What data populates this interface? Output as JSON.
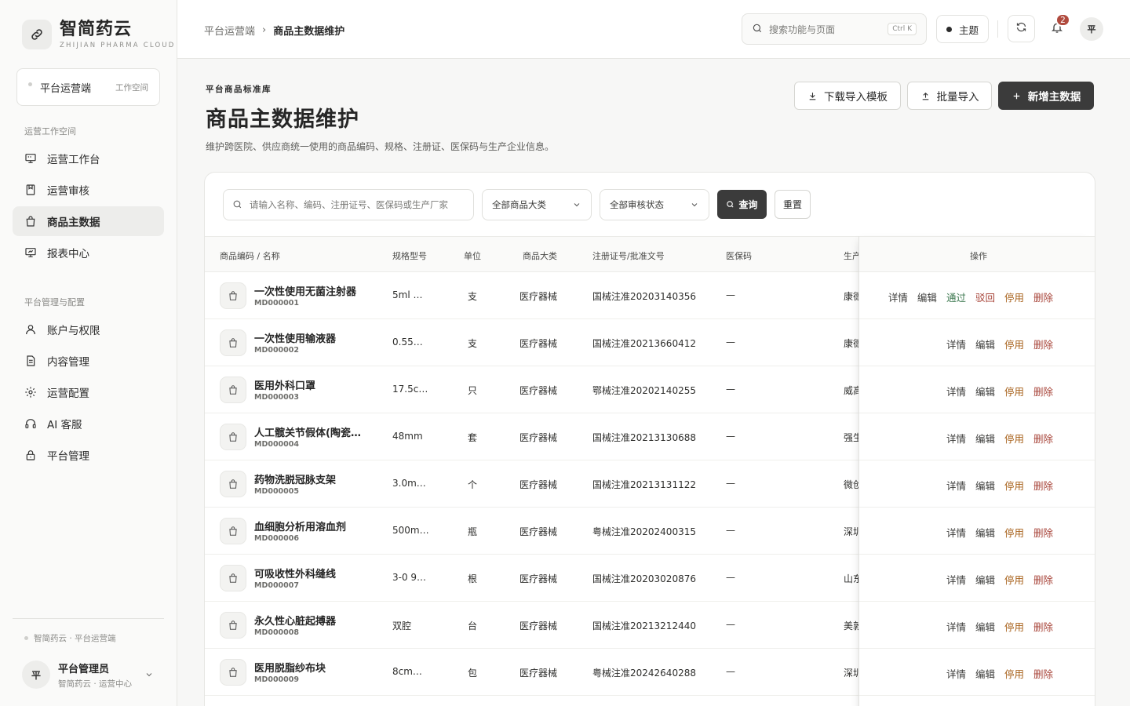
{
  "brand": {
    "name": "智简药云",
    "subtitle": "ZHIJIAN PHARMA CLOUD",
    "logo_icon": "link-icon"
  },
  "workspace": {
    "name": "平台运营端",
    "tag": "工作空间"
  },
  "sidebar": {
    "groups": [
      {
        "title": "运营工作空间",
        "items": [
          {
            "label": "运营工作台",
            "icon": "monitor-icon"
          },
          {
            "label": "运营审核",
            "icon": "review-icon"
          },
          {
            "label": "商品主数据",
            "icon": "bag-icon",
            "active": true
          },
          {
            "label": "报表中心",
            "icon": "chart-icon"
          }
        ]
      },
      {
        "title": "平台管理与配置",
        "items": [
          {
            "label": "账户与权限",
            "icon": "user-icon"
          },
          {
            "label": "内容管理",
            "icon": "document-icon"
          },
          {
            "label": "运营配置",
            "icon": "gear-icon"
          },
          {
            "label": "AI 客服",
            "icon": "headset-icon"
          },
          {
            "label": "平台管理",
            "icon": "lock-icon"
          }
        ]
      }
    ],
    "footer_note": "智简药云 · 平台运营端",
    "user": {
      "avatar": "平",
      "name": "平台管理员",
      "org": "智简药云 · 运营中心"
    }
  },
  "topbar": {
    "breadcrumb": [
      "平台运营端",
      "商品主数据维护"
    ],
    "search_placeholder": "搜索功能与页面",
    "search_shortcut": "Ctrl K",
    "theme_label": "主题",
    "notification_count": "2",
    "avatar": "平"
  },
  "page": {
    "eyebrow": "平台商品标准库",
    "title": "商品主数据维护",
    "description": "维护跨医院、供应商统一使用的商品编码、规格、注册证、医保码与生产企业信息。",
    "buttons": {
      "download": "下载导入模板",
      "import": "批量导入",
      "add": "新增主数据"
    }
  },
  "filters": {
    "search_placeholder": "请输入名称、编码、注册证号、医保码或生产厂家",
    "category": "全部商品大类",
    "status": "全部审核状态",
    "query": "查询",
    "reset": "重置"
  },
  "table": {
    "columns": {
      "name": "商品编码 / 名称",
      "spec": "规格型号",
      "unit": "单位",
      "category": "商品大类",
      "reg": "注册证号/批准文号",
      "insurance": "医保码",
      "mfr": "生产",
      "ops": "操作"
    },
    "ops_labels": {
      "detail": "详情",
      "edit": "编辑",
      "approve": "通过",
      "reject": "驳回",
      "disable": "停用",
      "delete": "删除"
    },
    "rows": [
      {
        "name": "一次性使用无菌注射器",
        "code": "MD000001",
        "spec": "5ml …",
        "unit": "支",
        "category": "医疗器械",
        "reg": "国械注准20203140356",
        "insurance": "—",
        "mfr": "康德",
        "pending": true
      },
      {
        "name": "一次性使用输液器",
        "code": "MD000002",
        "spec": "0.55…",
        "unit": "支",
        "category": "医疗器械",
        "reg": "国械注准20213660412",
        "insurance": "—",
        "mfr": "康德",
        "pending": false
      },
      {
        "name": "医用外科口罩",
        "code": "MD000003",
        "spec": "17.5c…",
        "unit": "只",
        "category": "医疗器械",
        "reg": "鄂械注准20202140255",
        "insurance": "—",
        "mfr": "威高",
        "pending": false
      },
      {
        "name": "人工髋关节假体(陶瓷…",
        "code": "MD000004",
        "spec": "48mm",
        "unit": "套",
        "category": "医疗器械",
        "reg": "国械注准20213130688",
        "insurance": "—",
        "mfr": "强生",
        "pending": false
      },
      {
        "name": "药物洗脱冠脉支架",
        "code": "MD000005",
        "spec": "3.0m…",
        "unit": "个",
        "category": "医疗器械",
        "reg": "国械注准20213131122",
        "insurance": "—",
        "mfr": "微创",
        "pending": false
      },
      {
        "name": "血细胞分析用溶血剂",
        "code": "MD000006",
        "spec": "500m…",
        "unit": "瓶",
        "category": "医疗器械",
        "reg": "粤械注准20202400315",
        "insurance": "—",
        "mfr": "深圳",
        "pending": false
      },
      {
        "name": "可吸收性外科缝线",
        "code": "MD000007",
        "spec": "3-0 9…",
        "unit": "根",
        "category": "医疗器械",
        "reg": "国械注准20203020876",
        "insurance": "—",
        "mfr": "山东",
        "pending": false
      },
      {
        "name": "永久性心脏起搏器",
        "code": "MD000008",
        "spec": "双腔",
        "unit": "台",
        "category": "医疗器械",
        "reg": "国械注准20213212440",
        "insurance": "—",
        "mfr": "美敦",
        "pending": false
      },
      {
        "name": "医用脱脂纱布块",
        "code": "MD000009",
        "spec": "8cm…",
        "unit": "包",
        "category": "医疗器械",
        "reg": "粤械注准20242640288",
        "insurance": "—",
        "mfr": "深圳",
        "pending": false
      }
    ]
  }
}
